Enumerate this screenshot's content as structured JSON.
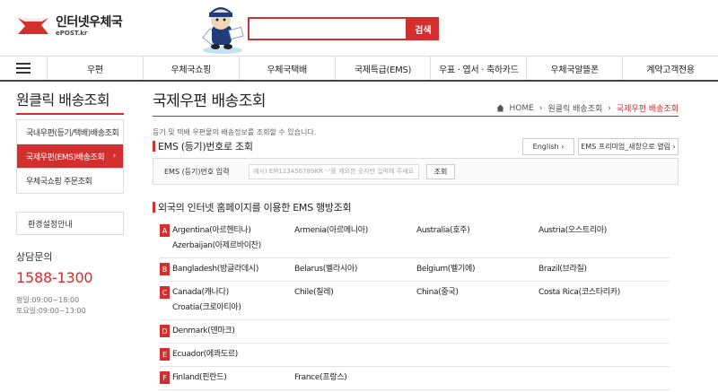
{
  "header": {
    "logo_main": "인터넷우체국",
    "logo_sub": "ePOST.kr",
    "search_placeholder": "",
    "search_button": "검색",
    "brand_color": "#d32f2f"
  },
  "nav": {
    "items": [
      "우편",
      "우체국쇼핑",
      "우체국택배",
      "국제특급(EMS)",
      "우표 · 엽서 · 축하카드",
      "우체국알뜰폰",
      "계약고객전용"
    ]
  },
  "sidebar": {
    "title": "원클릭 배송조회",
    "items": [
      {
        "label": "국내우편(등기/택배)배송조회"
      },
      {
        "label": "국제우편(EMS)배송조회",
        "active": true
      },
      {
        "label": "우체국쇼핑 주문조회"
      }
    ],
    "env_label": "환경설정안내",
    "contact_title": "상담문의",
    "phone": "1588-1300",
    "hours": [
      "평일:09:00~18:00",
      "토요일:09:00~13:00"
    ]
  },
  "main": {
    "title": "국제우편 배송조회",
    "breadcrumb": [
      "HOME",
      "원클릭 배송조회",
      "국제우편 배송조회"
    ],
    "desc": "등기 및 택배 우편물의 배송정보를 조회할 수 있습니다.",
    "section1_title": "EMS (등기)번호로 조회",
    "btn_english": "English",
    "btn_ems": "EMS 프리미엄_새창으로 열림",
    "ems_label": "EMS (등기)번호 입력",
    "ems_placeholder": "예시) EM123456789KR '-'를 제외한 숫자만 입력해 주세요",
    "ems_button": "조회",
    "section2_title": "외국의 인터넷 홈페이지를 이용한 EMS 행방조회"
  },
  "countries": [
    {
      "letter": "A",
      "items": [
        "Argentina(아르헨티나)",
        "Armenia(아르메니아)",
        "Australia(호주)",
        "Austria(오스트리아)",
        "Azerbaijan(아제르바이잔)"
      ]
    },
    {
      "letter": "B",
      "items": [
        "Bangladesh(방글라데시)",
        "Belarus(벨라시아)",
        "Belgium(벨기에)",
        "Brazil(브라질)"
      ]
    },
    {
      "letter": "C",
      "items": [
        "Canada(캐나다)",
        "Chile(칠레)",
        "China(중국)",
        "Costa Rica(코스타리카)",
        "Croatia(크로아티아)"
      ]
    },
    {
      "letter": "D",
      "items": [
        "Denmark(덴마크)"
      ]
    },
    {
      "letter": "E",
      "items": [
        "Ecuador(에콰도르)"
      ]
    },
    {
      "letter": "F",
      "items": [
        "Finland(핀란드)",
        "France(프랑스)"
      ]
    }
  ]
}
